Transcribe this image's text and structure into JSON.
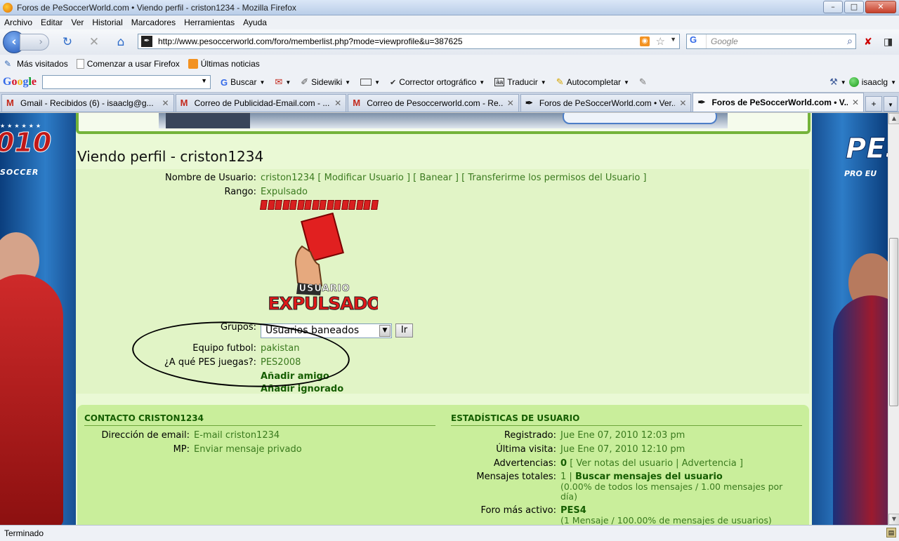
{
  "window": {
    "title": "Foros de PeSoccerWorld.com • Viendo perfil - criston1234 - Mozilla Firefox",
    "min": "–",
    "max": "□",
    "close": "✕"
  },
  "menu": [
    "Archivo",
    "Editar",
    "Ver",
    "Historial",
    "Marcadores",
    "Herramientas",
    "Ayuda"
  ],
  "nav": {
    "url": "http://www.pesoccerworld.com/foro/memberlist.php?mode=viewprofile&u=387625",
    "search_placeholder": "Google",
    "search_engine": "G"
  },
  "bookmarks": [
    "Más visitados",
    "Comenzar a usar Firefox",
    "Últimas noticias"
  ],
  "google_toolbar": {
    "logo": "Google",
    "items": [
      "Buscar",
      "Sidewiki",
      "Corrector ortográfico",
      "Traducir",
      "Autocompletar"
    ],
    "user": "isaaclg"
  },
  "tabs": [
    {
      "label": "Gmail - Recibidos (6) - isaaclg@g...",
      "icon": "gmail-icon",
      "active": false
    },
    {
      "label": "Correo de Publicidad-Email.com - ...",
      "icon": "gmail-icon",
      "active": false
    },
    {
      "label": "Correo de Pesoccerworld.com - Re...",
      "icon": "gmail-icon",
      "active": false
    },
    {
      "label": "Foros de PeSoccerWorld.com • Ver...",
      "icon": "pesoccer-icon",
      "active": false
    },
    {
      "label": "Foros de PeSoccerWorld.com • V...",
      "icon": "pesoccer-icon",
      "active": true
    }
  ],
  "side_banners": {
    "left_brand": "010",
    "left_sub": "SOCCER",
    "right_brand": "PES",
    "right_sub": "PRO EU"
  },
  "profile": {
    "page_title": "Viendo perfil - criston1234",
    "username_label": "Nombre de Usuario:",
    "username": "criston1234",
    "admin_links": "[ Modificar Usuario ] [ Banear ] [ Transferirme los permisos del Usuario ]",
    "rank_label": "Rango:",
    "rank": "Expulsado",
    "rank_image_top": "USUARIO",
    "rank_image_bottom": "EXPULSADO",
    "groups_label": "Grupos:",
    "groups_selected": "Usuarios baneados",
    "go_button": "Ir",
    "team_label": "Equipo futbol:",
    "team": "pakistan",
    "pes_label": "¿A qué PES juegas?:",
    "pes": "PES2008",
    "add_friend": "Añadir amigo",
    "add_ignored": "Añadir ignorado"
  },
  "contact": {
    "heading": "CONTACTO CRISTON1234",
    "email_label": "Dirección de email:",
    "email": "E-mail criston1234",
    "pm_label": "MP:",
    "pm": "Enviar mensaje privado"
  },
  "stats": {
    "heading": "ESTADÍSTICAS DE USUARIO",
    "registered_label": "Registrado:",
    "registered": "Jue Ene 07, 2010 12:03 pm",
    "last_visit_label": "Última visita:",
    "last_visit": "Jue Ene 07, 2010 12:10 pm",
    "warnings_label": "Advertencias:",
    "warnings_count": "0",
    "warnings_links": "[ Ver notas del usuario | Advertencia ]",
    "posts_label": "Mensajes totales:",
    "posts_count": "1 |",
    "posts_search": "Buscar mensajes del usuario",
    "posts_detail": "(0.00% de todos los mensajes / 1.00 mensajes por día)",
    "active_label": "Foro más activo:",
    "active_forum": "PES4",
    "active_detail": "(1 Mensaje / 100.00% de mensajes de usuarios)"
  },
  "status": "Terminado"
}
